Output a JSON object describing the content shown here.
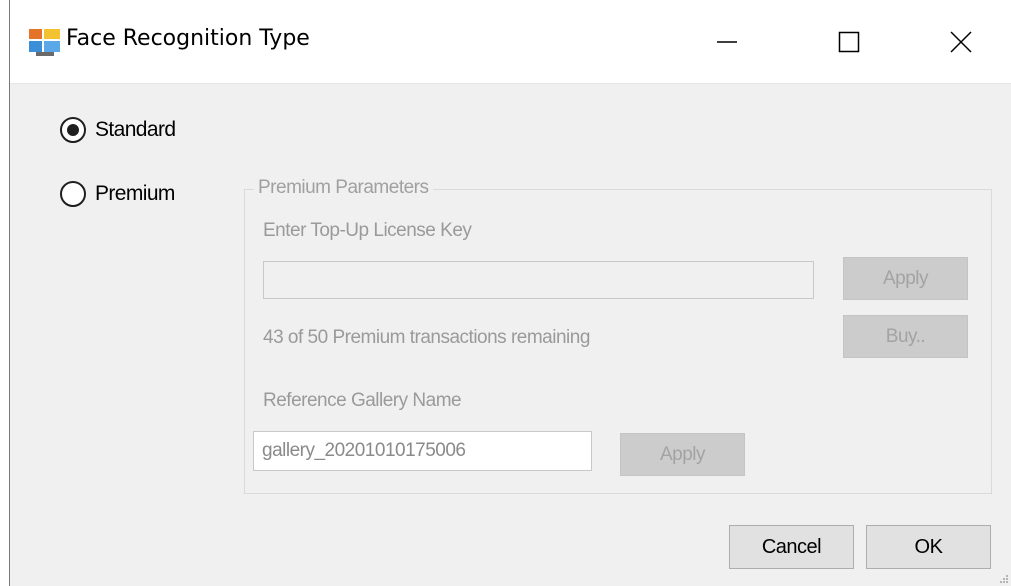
{
  "window": {
    "title": "Face Recognition Type",
    "icon": "app-window-icon",
    "controls": [
      "minimize-icon",
      "maximize-icon",
      "close-icon"
    ]
  },
  "options": {
    "standard": {
      "label": "Standard",
      "checked": true
    },
    "premium": {
      "label": "Premium",
      "checked": false
    }
  },
  "premium_params": {
    "legend": "Premium Parameters",
    "license_key_label": "Enter Top-Up License Key",
    "license_key_value": "",
    "apply_license_label": "Apply",
    "transactions_text": "43 of 50 Premium transactions remaining",
    "buy_label": "Buy..",
    "gallery_label": "Reference Gallery Name",
    "gallery_value": "gallery_20201010175006",
    "apply_gallery_label": "Apply"
  },
  "footer": {
    "cancel_label": "Cancel",
    "ok_label": "OK"
  }
}
